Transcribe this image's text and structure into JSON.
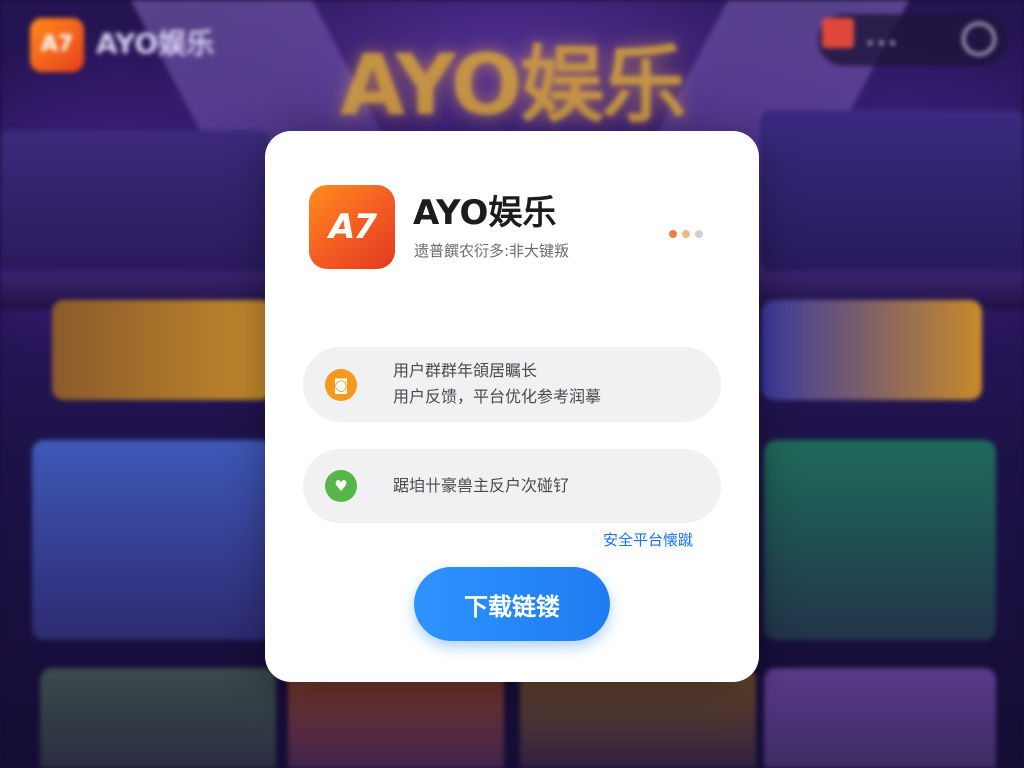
{
  "background": {
    "corner_logo_glyph": "A7",
    "corner_logo_text": "AYO娱乐",
    "hero_title": "AYO娱乐",
    "topbar_dots": "•••"
  },
  "dialog": {
    "app_icon_glyph": "A7",
    "app_name": "AYO娱乐",
    "app_subtitle": "遗普饌农衍多:非大键叛",
    "pager": {
      "count": 3,
      "active_index": 0,
      "colors": [
        "#f07d3a",
        "#f0b98a",
        "#d0d0d0"
      ]
    },
    "rows": [
      {
        "icon": "camera-badge-icon",
        "icon_glyph": "◙",
        "line1": "用户群群年頜居瞩长",
        "line2": "用户反馈，平台优化参考润摹"
      },
      {
        "icon": "heart-shield-icon",
        "icon_glyph": "♥",
        "line1": "踞垍卄豪兽主反户次碰钌"
      }
    ],
    "safe_link": "安全平台懐蹴",
    "download_label": "下载链镂"
  },
  "colors": {
    "accent": "#1f7cf0",
    "brand_orange": "#f25a23",
    "link": "#1a73e8"
  }
}
